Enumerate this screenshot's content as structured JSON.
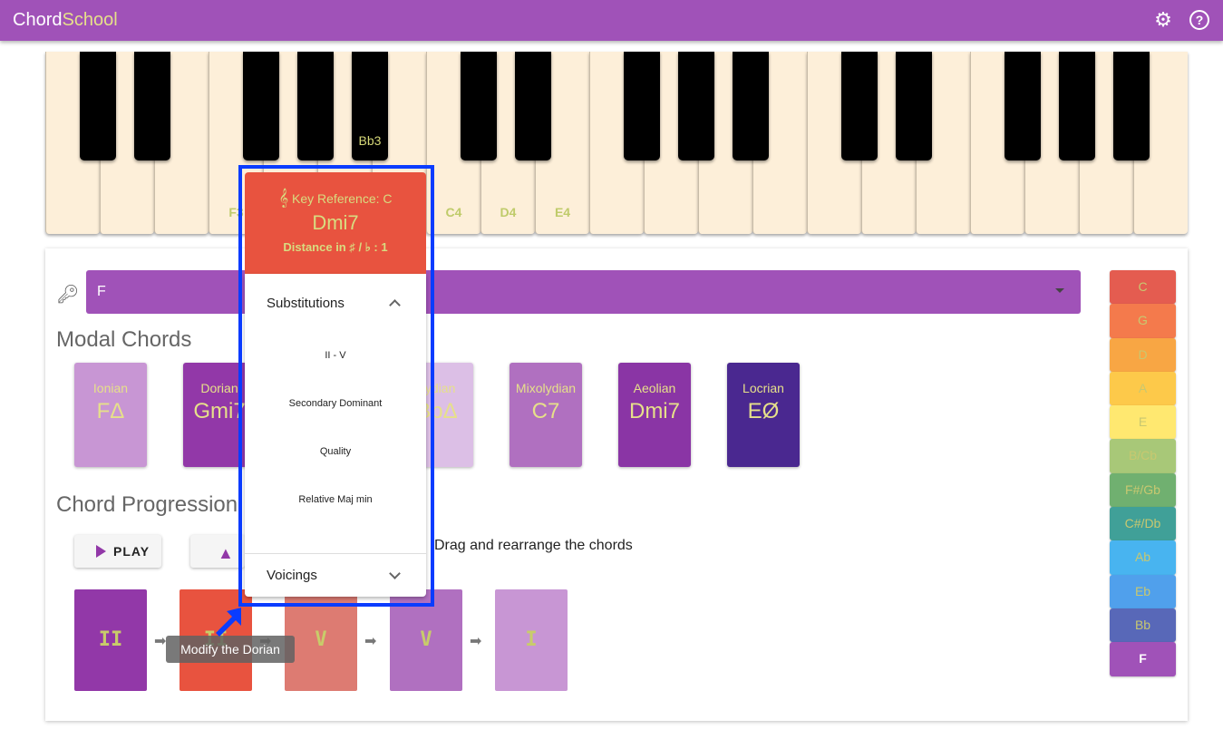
{
  "app": {
    "title_a": "Chord",
    "title_b": "School",
    "icons": [
      "gear-icon",
      "help-icon"
    ]
  },
  "piano": {
    "white_labels": {
      "3": "F3",
      "7": "C4",
      "8": "D4",
      "9": "E4"
    },
    "black_labels": {
      "4": "Bb3"
    }
  },
  "key_select": {
    "value": "F",
    "icon": "key-icon"
  },
  "modal": {
    "heading": "Modal Chords",
    "cards": [
      {
        "mode": "Ionian",
        "chord": "FΔ",
        "color": "#c896d4"
      },
      {
        "mode": "Dorian",
        "chord": "Gmi7",
        "color": "#9238a8"
      },
      {
        "mode": "",
        "chord": "",
        "color": "#a860bc"
      },
      {
        "mode": "Lydian",
        "chord": "BbΔ",
        "color": "#dcbfe6"
      },
      {
        "mode": "Mixolydian",
        "chord": "C7",
        "color": "#b070c0"
      },
      {
        "mode": "Aeolian",
        "chord": "Dmi7",
        "color": "#8a35a5"
      },
      {
        "mode": "Locrian",
        "chord": "EØ",
        "color": "#4a2890"
      }
    ]
  },
  "progression": {
    "heading": "Chord Progression",
    "play": "PLAY",
    "hint": "Drag and rearrange the chords",
    "chords": [
      {
        "label": "II",
        "color": "#9238a8"
      },
      {
        "label": "II",
        "color": "#e8533f"
      },
      {
        "label": "V",
        "color": "#dd7b72"
      },
      {
        "label": "V",
        "color": "#b070c0"
      },
      {
        "label": "I",
        "color": "#c896d4"
      }
    ],
    "tooltip": "Modify the Dorian"
  },
  "keys": [
    {
      "k": "C",
      "c": "#e45c50"
    },
    {
      "k": "G",
      "c": "#f47a4c"
    },
    {
      "k": "D",
      "c": "#f8a644"
    },
    {
      "k": "A",
      "c": "#fdc94a"
    },
    {
      "k": "E",
      "c": "#ffe870"
    },
    {
      "k": "B/Cb",
      "c": "#a8c878"
    },
    {
      "k": "F#/Gb",
      "c": "#70b070"
    },
    {
      "k": "C#/Db",
      "c": "#40a098"
    },
    {
      "k": "Ab",
      "c": "#48b4f0"
    },
    {
      "k": "Eb",
      "c": "#50a0ec"
    },
    {
      "k": "Bb",
      "c": "#5868b8"
    },
    {
      "k": "F",
      "c": "#a052b8",
      "selected": true
    }
  ],
  "popup": {
    "ref": "Key Reference: C",
    "chord": "Dmi7",
    "distance": "Distance in ♯ / ♭ : 1",
    "substitutions": "Substitutions",
    "options": [
      "II - V",
      "Secondary Dominant",
      "Quality",
      "Relative Maj min"
    ],
    "voicings": "Voicings"
  }
}
